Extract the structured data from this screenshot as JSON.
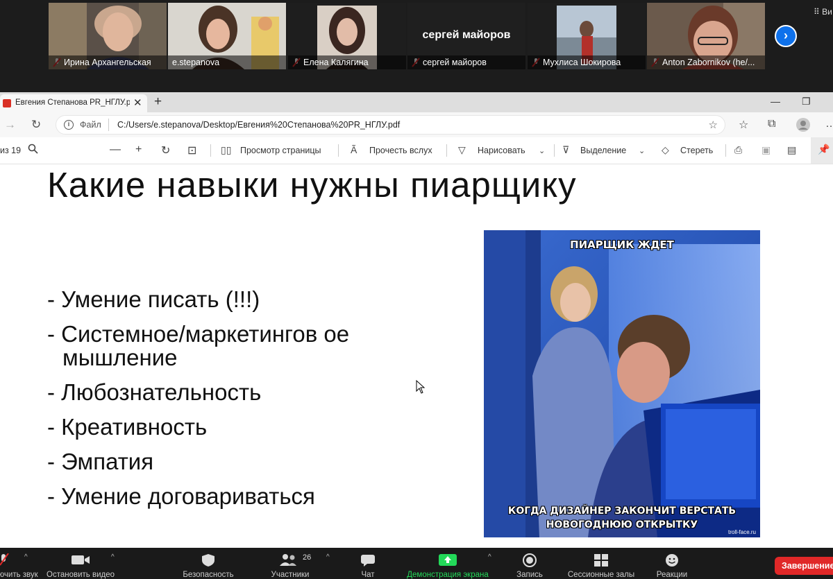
{
  "gallery": {
    "participants": [
      {
        "name": "Ирина Архангельская",
        "muted": true
      },
      {
        "name": "e.stepanova",
        "muted": false,
        "active": true
      },
      {
        "name": "Елена Калягина",
        "muted": true
      },
      {
        "name": "сергей майоров",
        "muted": true,
        "avatar_text": "сергей майоров"
      },
      {
        "name": "Мухлиса Шокирова",
        "muted": true
      },
      {
        "name": "Anton Zabornikov (he/...",
        "muted": true
      }
    ],
    "next_label": "›",
    "view_label": "Ви"
  },
  "browser": {
    "tab_title": "Евгения Степанова PR_НГЛУ.pdf",
    "tab_close": "✕",
    "new_tab": "+",
    "address": {
      "scheme_label": "Файл",
      "url": "C:/Users/e.stepanova/Desktop/Евгения%20Степанова%20PR_НГЛУ.pdf"
    },
    "pdf_toolbar": {
      "page_of": "из 19",
      "page_view": "Просмотр страницы",
      "read_aloud": "Прочесть вслух",
      "draw": "Нарисовать",
      "highlight": "Выделение",
      "erase": "Стереть"
    }
  },
  "slide": {
    "title": "Какие навыки нужны пиарщику",
    "bullets": [
      "- Умение писать (!!!)",
      "- Системное/маркетингов ое мышление",
      "- Любознательность",
      "- Креативность",
      "- Эмпатия",
      "- Умение договариваться"
    ],
    "meme": {
      "top_caption": "ПИАРЩИК ЖДЕТ",
      "bottom_caption_1": "КОГДА ДИЗАЙНЕР ЗАКОНЧИТ ВЕРСТАТЬ",
      "bottom_caption_2": "НОВОГОДНЮЮ ОТКРЫТКУ",
      "credit": "troll-face.ru"
    }
  },
  "zoom_toolbar": {
    "audio": "Включить звук",
    "video": "Остановить видео",
    "security": "Безопасность",
    "participants": "Участники",
    "participants_count": "26",
    "chat": "Чат",
    "share": "Демонстрация экрана",
    "record": "Запись",
    "breakout": "Сессионные залы",
    "reactions": "Реакции",
    "end": "Завершение"
  },
  "colors": {
    "zoom_bg": "#1a1a1a",
    "share_green": "#23d959",
    "end_red": "#e02828",
    "active_speaker": "#c9d63a",
    "next_blue": "#0e71eb"
  }
}
